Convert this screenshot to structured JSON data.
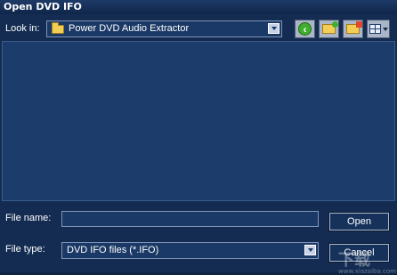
{
  "window": {
    "title": "Open DVD IFO"
  },
  "toolbar": {
    "look_in_label": "Look in:",
    "look_in_value": "Power DVD Audio Extractor",
    "icons": [
      "back-icon",
      "up-folder-icon",
      "new-folder-icon",
      "view-menu-icon"
    ]
  },
  "file_list": {
    "items": []
  },
  "form": {
    "file_name_label": "File name:",
    "file_name_value": "",
    "file_type_label": "File type:",
    "file_type_value": "DVD IFO files (*.IFO)",
    "open_label": "Open",
    "cancel_label": "Cancel"
  },
  "watermark": {
    "text": "下载",
    "sub": "www.xiazaiba.com"
  },
  "colors": {
    "dialog_bg": "#142c52",
    "list_bg": "#1c3d6c",
    "field_bg": "#1b3966",
    "accent_green": "#3fae2f",
    "folder_yellow": "#f2cf54"
  }
}
